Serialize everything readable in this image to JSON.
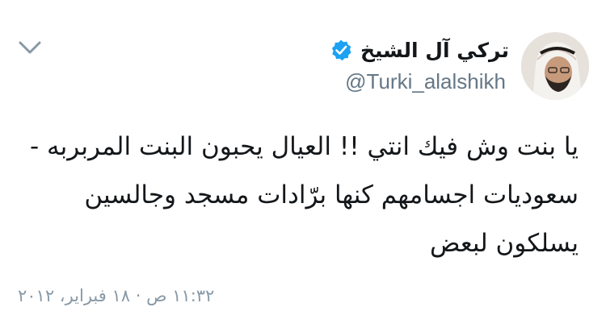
{
  "tweet": {
    "author": {
      "display_name": "تركي آل الشيخ",
      "handle": "@Turki_alalshikh",
      "verified": true,
      "avatar_icon": "profile-photo"
    },
    "menu_icon": "chevron-down-icon",
    "text_lines": [
      "يا بنت وش فيك انتي !! العيال يحبون البنت المربربه -",
      "سعوديات اجسامهم كنها برّادات مسجد وجالسين",
      "يسلكون لبعض"
    ],
    "timestamp": "١١:٣٢ ص · ١٨ فبراير، ٢٠١٢"
  },
  "colors": {
    "text": "#14171a",
    "secondary": "#657786",
    "timestamp": "#8899a6",
    "verified_badge": "#1da1f2",
    "caret": "#8899a6"
  }
}
